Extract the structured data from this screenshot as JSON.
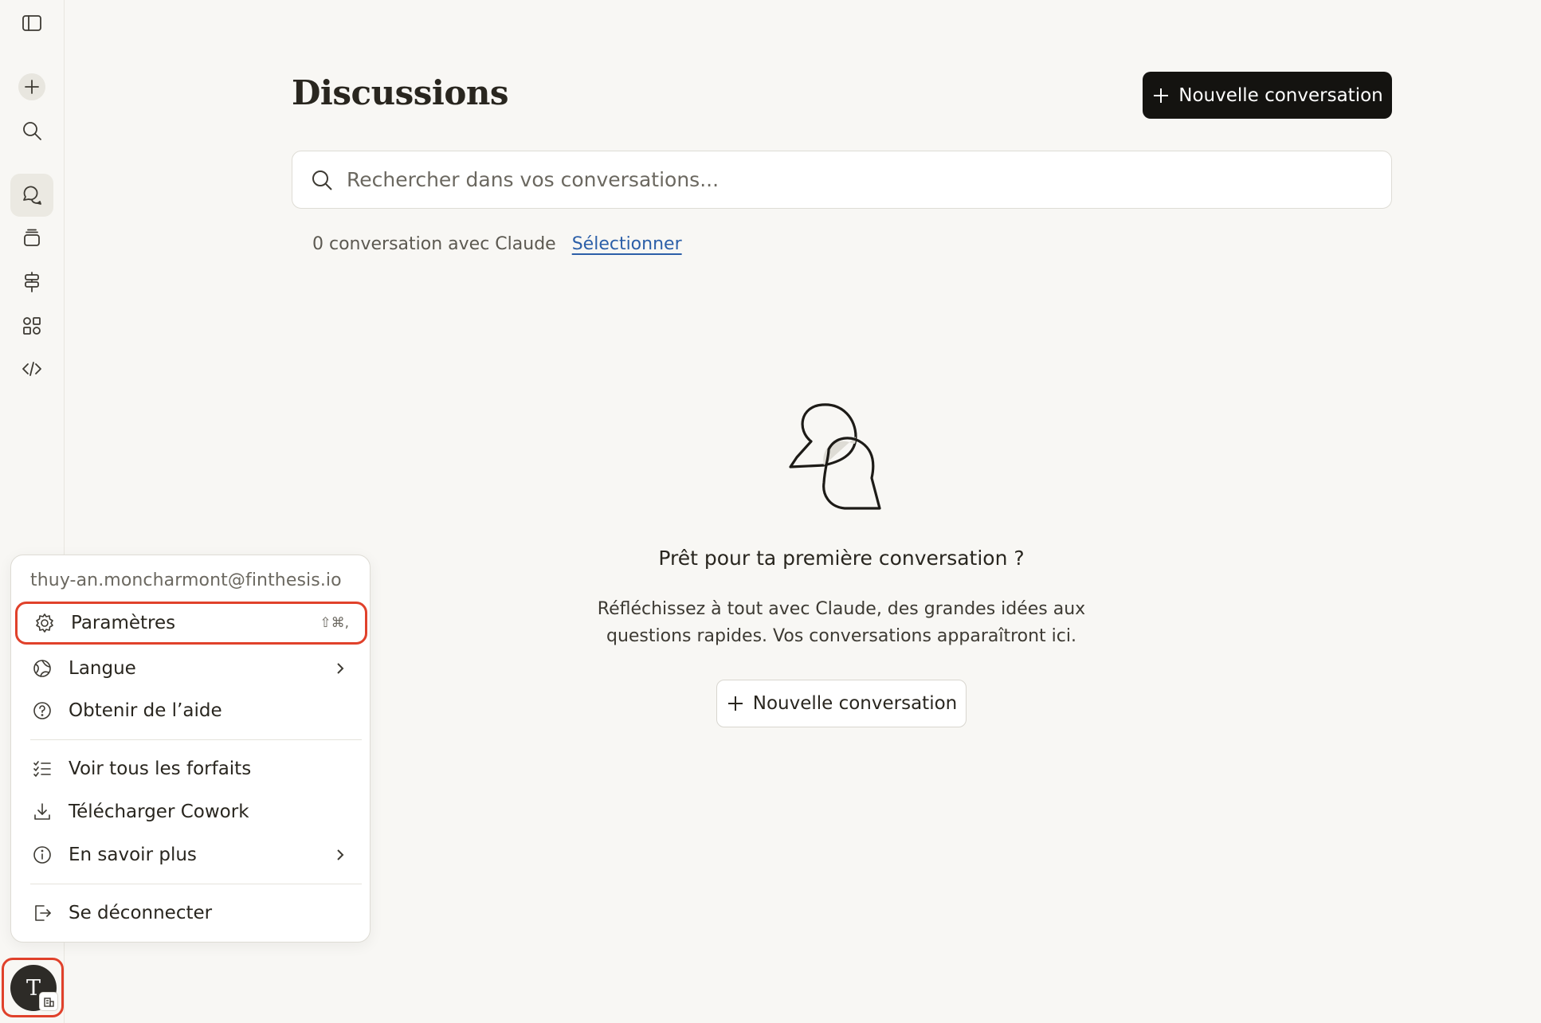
{
  "page": {
    "title": "Discussions",
    "new_conversation_label": "Nouvelle conversation"
  },
  "search": {
    "placeholder": "Rechercher dans vos conversations...",
    "value": ""
  },
  "conversations": {
    "count_text": "0 conversation avec Claude",
    "select_label": "Sélectionner"
  },
  "empty_state": {
    "title": "Prêt pour ta première conversation ?",
    "description_line1": "Réfléchissez à tout avec Claude, des grandes idées aux",
    "description_line2": "questions rapides. Vos conversations apparaîtront ici.",
    "button_label": "Nouvelle conversation",
    "illustration": "speech-bubbles-icon"
  },
  "rail": {
    "items": [
      {
        "name": "sidebar-toggle-icon"
      },
      {
        "name": "new-chat-icon"
      },
      {
        "name": "search-icon"
      },
      {
        "name": "chats-icon",
        "active": true
      },
      {
        "name": "projects-icon"
      },
      {
        "name": "signpost-icon"
      },
      {
        "name": "artifacts-icon"
      },
      {
        "name": "code-icon"
      }
    ],
    "avatar_initial": "T"
  },
  "user_menu": {
    "email": "thuy-an.moncharmont@finthesis.io",
    "items": [
      {
        "label": "Paramètres",
        "icon": "gear-icon",
        "shortcut": "⇧⌘,"
      },
      {
        "label": "Langue",
        "icon": "globe-icon",
        "submenu": true
      },
      {
        "label": "Obtenir de l’aide",
        "icon": "help-circle-icon"
      },
      {
        "label": "Voir tous les forfaits",
        "icon": "list-icon"
      },
      {
        "label": "Télécharger Cowork",
        "icon": "download-icon"
      },
      {
        "label": "En savoir plus",
        "icon": "info-icon",
        "submenu": true
      },
      {
        "label": "Se déconnecter",
        "icon": "logout-icon"
      }
    ]
  },
  "colors": {
    "background": "#f8f7f4",
    "primary_button": "#141310",
    "link": "#2c5fa8",
    "highlight_outline": "#e0412b"
  }
}
